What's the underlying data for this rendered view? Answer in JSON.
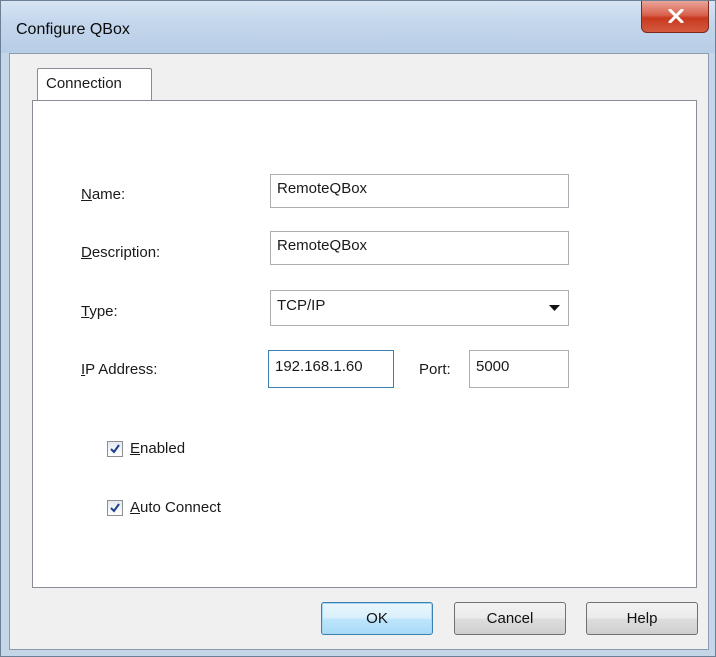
{
  "window": {
    "title": "Configure QBox"
  },
  "tabs": [
    {
      "label": "Connection"
    }
  ],
  "form": {
    "name_label_accel": "N",
    "name_label_rest": "ame:",
    "name_value": "RemoteQBox",
    "description_label_accel": "D",
    "description_label_rest": "escription:",
    "description_value": "RemoteQBox",
    "type_label_accel": "T",
    "type_label_rest": "ype:",
    "type_value": "TCP/IP",
    "ip_label_accel": "I",
    "ip_label_rest": "P Address:",
    "ip_value": "192.168.1.60",
    "port_label": "Port:",
    "port_value": "5000",
    "enabled_label_accel": "E",
    "enabled_label_rest": "nabled",
    "enabled_checked": true,
    "autoconnect_label_accel": "A",
    "autoconnect_label_rest": "uto Connect",
    "autoconnect_checked": true
  },
  "buttons": {
    "ok": "OK",
    "cancel": "Cancel",
    "help": "Help"
  },
  "icons": {
    "close": "close-icon",
    "dropdown": "chevron-down-icon",
    "check": "checkmark-icon"
  }
}
